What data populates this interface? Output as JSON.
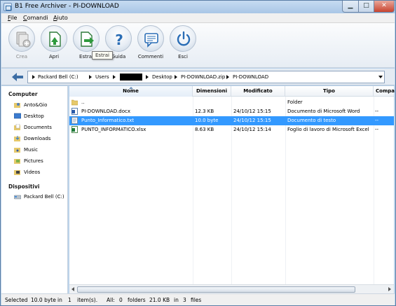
{
  "window": {
    "title": "B1 Free Archiver - PI-DOWNLOAD"
  },
  "menu": {
    "items": [
      "File",
      "Comandi",
      "Aiuto"
    ]
  },
  "toolbar": {
    "buttons": [
      {
        "label": "Crea",
        "icon": "create-archive-icon",
        "enabled": false
      },
      {
        "label": "Apri",
        "icon": "open-archive-icon",
        "enabled": true
      },
      {
        "label": "Estrai",
        "icon": "extract-icon",
        "enabled": true
      },
      {
        "label": "Guida",
        "icon": "help-icon",
        "enabled": true
      },
      {
        "label": "Commenti",
        "icon": "comment-icon",
        "enabled": true
      },
      {
        "label": "Esci",
        "icon": "power-icon",
        "enabled": true
      }
    ],
    "tooltip": "Estrai"
  },
  "breadcrumb": {
    "items": [
      "Packard Bell (C:)",
      "Users",
      "",
      "Desktop",
      "PI-DOWNLOAD.zip",
      "PI-DOWNLOAD"
    ]
  },
  "sidebar": {
    "computer_heading": "Computer",
    "computer_items": [
      "Anto&Gio",
      "Desktop",
      "Documents",
      "Downloads",
      "Music",
      "Pictures",
      "Videos"
    ],
    "devices_heading": "Dispositivi",
    "device_items": [
      "Packard Bell (C:)"
    ]
  },
  "columns": [
    "Nome",
    "Dimensioni",
    "Modificato",
    "Tipo",
    "Compa"
  ],
  "files": [
    {
      "name": "..",
      "size": "",
      "modified": "",
      "type": "Folder",
      "compressed": "",
      "icon": "folder-icon",
      "selected": false
    },
    {
      "name": "PI-DOWNLOAD.docx",
      "size": "12.3 KB",
      "modified": "24/10/12 15:15",
      "type": "Documento di Microsoft Word",
      "compressed": "--",
      "icon": "word-doc-icon",
      "selected": false
    },
    {
      "name": "Punto_Informatico.txt",
      "size": "10.0 byte",
      "modified": "24/10/12 15:15",
      "type": "Documento di testo",
      "compressed": "--",
      "icon": "text-file-icon",
      "selected": true
    },
    {
      "name": "PUNTO_INFORMATICO.xlsx",
      "size": "8.63 KB",
      "modified": "24/10/12 15:14",
      "type": "Foglio di lavoro di Microsoft Excel",
      "compressed": "--",
      "icon": "excel-doc-icon",
      "selected": false
    }
  ],
  "status": {
    "selected_label": "Selected",
    "selected_size": "10.0 byte",
    "in1": "in",
    "selected_count": "1",
    "items_label": "item(s).",
    "all_label": "All:",
    "folder_count": "0",
    "folders_label": "folders",
    "total_size": "21.0 KB",
    "in2": "in",
    "file_count": "3",
    "files_label": "files"
  },
  "colors": {
    "selection": "#3399ff",
    "window_frame": "#bcd3ea"
  }
}
